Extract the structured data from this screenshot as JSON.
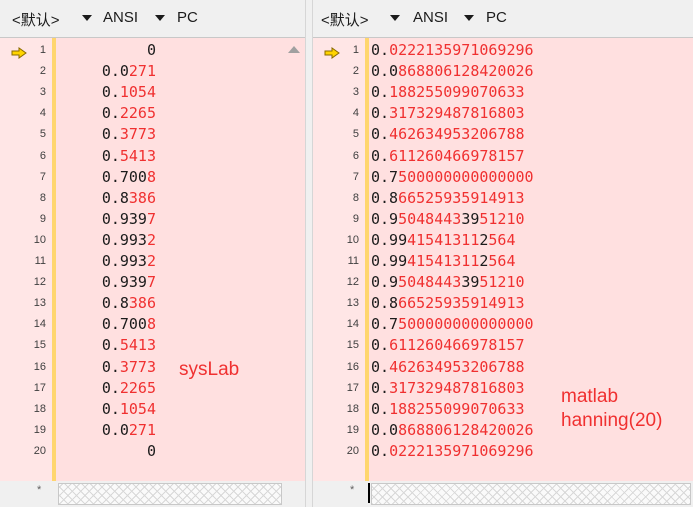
{
  "left_pane": {
    "toolbar": {
      "encoding_label": "<默认>",
      "charset": "ANSI",
      "line_end": "PC"
    },
    "annotation": "sysLab",
    "rows": [
      {
        "n": "1",
        "blk": "0",
        "red": ""
      },
      {
        "n": "2",
        "blk": "0.0",
        "red": "271"
      },
      {
        "n": "3",
        "blk": "0.",
        "red": "1054"
      },
      {
        "n": "4",
        "blk": "0.",
        "red": "2265"
      },
      {
        "n": "5",
        "blk": "0.",
        "red": "3773"
      },
      {
        "n": "6",
        "blk": "0.",
        "red": "5413"
      },
      {
        "n": "7",
        "blk": "0.700",
        "red": "8"
      },
      {
        "n": "8",
        "blk": "0.8",
        "red": "386"
      },
      {
        "n": "9",
        "blk": "0.939",
        "red": "7"
      },
      {
        "n": "10",
        "blk": "0.993",
        "red": "2"
      },
      {
        "n": "11",
        "blk": "0.993",
        "red": "2"
      },
      {
        "n": "12",
        "blk": "0.939",
        "red": "7"
      },
      {
        "n": "13",
        "blk": "0.8",
        "red": "386"
      },
      {
        "n": "14",
        "blk": "0.700",
        "red": "8"
      },
      {
        "n": "15",
        "blk": "0.",
        "red": "5413"
      },
      {
        "n": "16",
        "blk": "0.",
        "red": "3773"
      },
      {
        "n": "17",
        "blk": "0.",
        "red": "2265"
      },
      {
        "n": "18",
        "blk": "0.",
        "red": "1054"
      },
      {
        "n": "19",
        "blk": "0.0",
        "red": "271"
      },
      {
        "n": "20",
        "blk": "0",
        "red": ""
      }
    ],
    "footer_marker": "*"
  },
  "right_pane": {
    "toolbar": {
      "encoding_label": "<默认>",
      "charset": "ANSI",
      "line_end": "PC"
    },
    "annotation_line1": "matlab",
    "annotation_line2": "hanning(20)",
    "rows": [
      {
        "n": "1",
        "parts": [
          [
            "k",
            "0."
          ],
          [
            "r",
            "0222135971069296"
          ]
        ]
      },
      {
        "n": "2",
        "parts": [
          [
            "k",
            "0.0"
          ],
          [
            "r",
            "868806128420026"
          ]
        ]
      },
      {
        "n": "3",
        "parts": [
          [
            "k",
            "0."
          ],
          [
            "r",
            "188255099070633"
          ]
        ]
      },
      {
        "n": "4",
        "parts": [
          [
            "k",
            "0."
          ],
          [
            "r",
            "317329487816803"
          ]
        ]
      },
      {
        "n": "5",
        "parts": [
          [
            "k",
            "0."
          ],
          [
            "r",
            "462634953206788"
          ]
        ]
      },
      {
        "n": "6",
        "parts": [
          [
            "k",
            "0."
          ],
          [
            "r",
            "611260466978157"
          ]
        ]
      },
      {
        "n": "7",
        "parts": [
          [
            "k",
            "0.7"
          ],
          [
            "r",
            "500000000000000"
          ]
        ]
      },
      {
        "n": "8",
        "parts": [
          [
            "k",
            "0.8"
          ],
          [
            "r",
            "66525935914913"
          ]
        ]
      },
      {
        "n": "9",
        "parts": [
          [
            "k",
            "0.9"
          ],
          [
            "r",
            "5048443"
          ],
          [
            "k",
            "39"
          ],
          [
            "r",
            "51210"
          ]
        ]
      },
      {
        "n": "10",
        "parts": [
          [
            "k",
            "0.99"
          ],
          [
            "r",
            "41541311"
          ],
          [
            "k",
            "2"
          ],
          [
            "r",
            "564"
          ]
        ]
      },
      {
        "n": "11",
        "parts": [
          [
            "k",
            "0.99"
          ],
          [
            "r",
            "41541311"
          ],
          [
            "k",
            "2"
          ],
          [
            "r",
            "564"
          ]
        ]
      },
      {
        "n": "12",
        "parts": [
          [
            "k",
            "0.9"
          ],
          [
            "r",
            "5048443"
          ],
          [
            "k",
            "39"
          ],
          [
            "r",
            "51210"
          ]
        ]
      },
      {
        "n": "13",
        "parts": [
          [
            "k",
            "0.8"
          ],
          [
            "r",
            "66525935914913"
          ]
        ]
      },
      {
        "n": "14",
        "parts": [
          [
            "k",
            "0.7"
          ],
          [
            "r",
            "500000000000000"
          ]
        ]
      },
      {
        "n": "15",
        "parts": [
          [
            "k",
            "0."
          ],
          [
            "r",
            "611260466978157"
          ]
        ]
      },
      {
        "n": "16",
        "parts": [
          [
            "k",
            "0."
          ],
          [
            "r",
            "462634953206788"
          ]
        ]
      },
      {
        "n": "17",
        "parts": [
          [
            "k",
            "0."
          ],
          [
            "r",
            "317329487816803"
          ]
        ]
      },
      {
        "n": "18",
        "parts": [
          [
            "k",
            "0."
          ],
          [
            "r",
            "188255099070633"
          ]
        ]
      },
      {
        "n": "19",
        "parts": [
          [
            "k",
            "0.0"
          ],
          [
            "r",
            "868806128420026"
          ]
        ]
      },
      {
        "n": "20",
        "parts": [
          [
            "k",
            "0."
          ],
          [
            "r",
            "0222135971069296"
          ]
        ]
      }
    ],
    "footer_marker": "*"
  },
  "icons": {
    "current_line": "arrow-right-icon",
    "dropdown": "triangle-down-icon",
    "scroll": "scroll-up-icon"
  },
  "colors": {
    "text_red": "#f03030",
    "text_black": "#1b1b1b",
    "editor_bg": "#ffe0e0",
    "gutter_sep": "#ffd66e"
  }
}
